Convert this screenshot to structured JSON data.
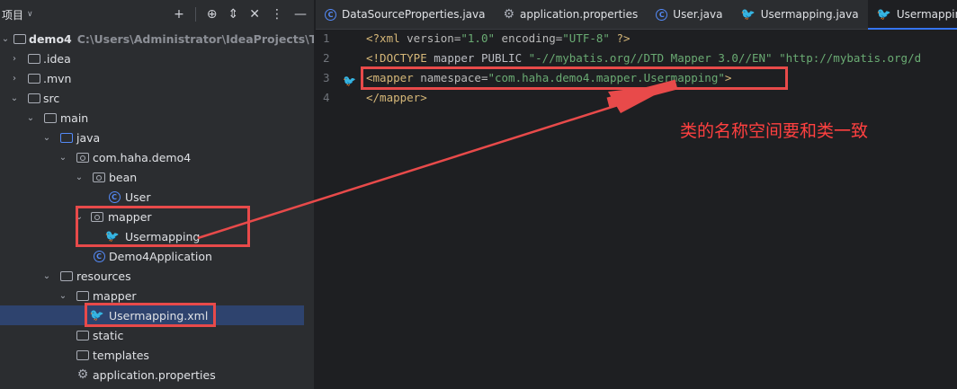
{
  "project_panel": {
    "title": "项目",
    "tree": [
      {
        "label": "demo4",
        "path": "C:\\Users\\Administrator\\IdeaProjects\\Test\\dem"
      },
      {
        "label": ".idea"
      },
      {
        "label": ".mvn"
      },
      {
        "label": "src"
      },
      {
        "label": "main"
      },
      {
        "label": "java"
      },
      {
        "label": "com.haha.demo4"
      },
      {
        "label": "bean"
      },
      {
        "label": "User"
      },
      {
        "label": "mapper"
      },
      {
        "label": "Usermapping"
      },
      {
        "label": "Demo4Application"
      },
      {
        "label": "resources"
      },
      {
        "label": "mapper"
      },
      {
        "label": "Usermapping.xml"
      },
      {
        "label": "static"
      },
      {
        "label": "templates"
      },
      {
        "label": "application.properties"
      }
    ]
  },
  "tabs": [
    {
      "label": "DataSourceProperties.java",
      "icon": "class-icon"
    },
    {
      "label": "application.properties",
      "icon": "gear-icon"
    },
    {
      "label": "User.java",
      "icon": "class-icon"
    },
    {
      "label": "Usermapping.java",
      "icon": "mapper-icon"
    },
    {
      "label": "Usermapping.xml",
      "icon": "mapper-icon",
      "active": true
    }
  ],
  "editor": {
    "line_numbers": [
      "1",
      "2",
      "3",
      "4"
    ],
    "line1": {
      "tag_open": "<?xml ",
      "attr1": "version=",
      "val1": "\"1.0\"",
      "sp": " ",
      "attr2": "encoding=",
      "val2": "\"UTF-8\"",
      "tag_close": " ?>"
    },
    "line2": {
      "tag_open": "<!DOCTYPE ",
      "plain": "mapper PUBLIC ",
      "str1": "\"-//mybatis.org//DTD Mapper 3.0//EN\"",
      "sp": " ",
      "str2": "\"http://mybatis.org/d"
    },
    "line3": {
      "tag_open": "<mapper ",
      "attr": "namespace=",
      "val": "\"com.haha.demo4.mapper.Usermapping\"",
      "tag_close": ">"
    },
    "line4": {
      "tag": "</mapper>"
    }
  },
  "annotation": {
    "text": "类的名称空间要和类一致",
    "color": "#e84a4a"
  },
  "colors": {
    "accent": "#3574f0",
    "selection": "#2e436e",
    "annotation_red": "#e84a4a"
  }
}
